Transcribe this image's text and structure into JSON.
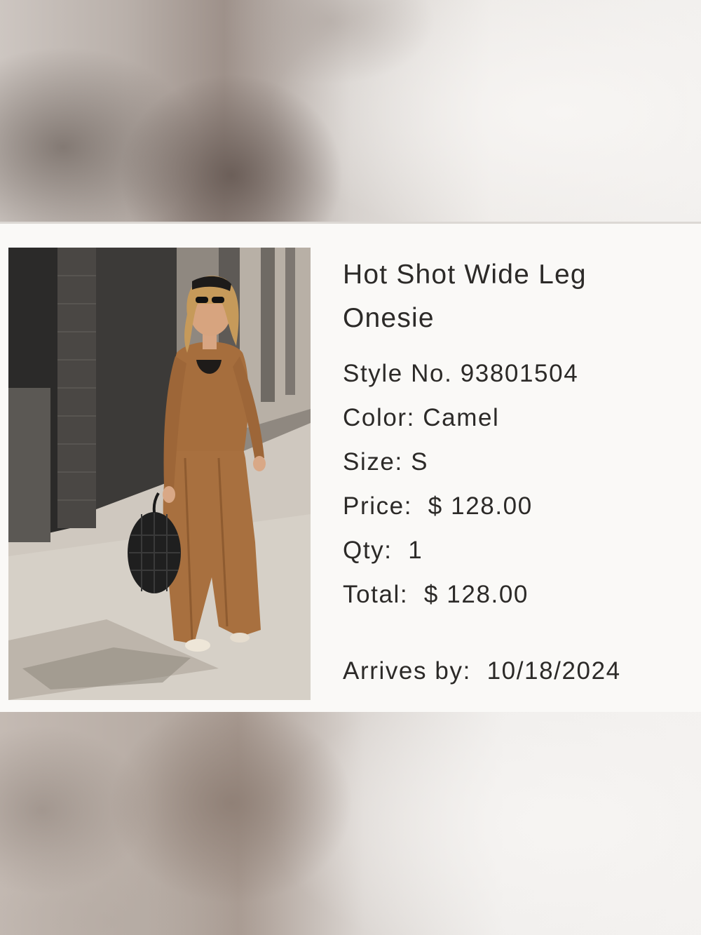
{
  "product": {
    "title": "Hot Shot Wide Leg Onesie",
    "style_label": "Style No.",
    "style_number": "93801504",
    "color_label": "Color:",
    "color_value": "Camel",
    "size_label": "Size:",
    "size_value": "S",
    "price_label": "Price:",
    "price_value": "$ 128.00",
    "qty_label": "Qty:",
    "qty_value": "1",
    "total_label": "Total:",
    "total_value": "$ 128.00",
    "arrives_label": "Arrives by:",
    "arrives_value": "10/18/2024"
  },
  "colors": {
    "text": "#2c2a28",
    "card": "#faf9f7",
    "garment": "#a8703f"
  }
}
